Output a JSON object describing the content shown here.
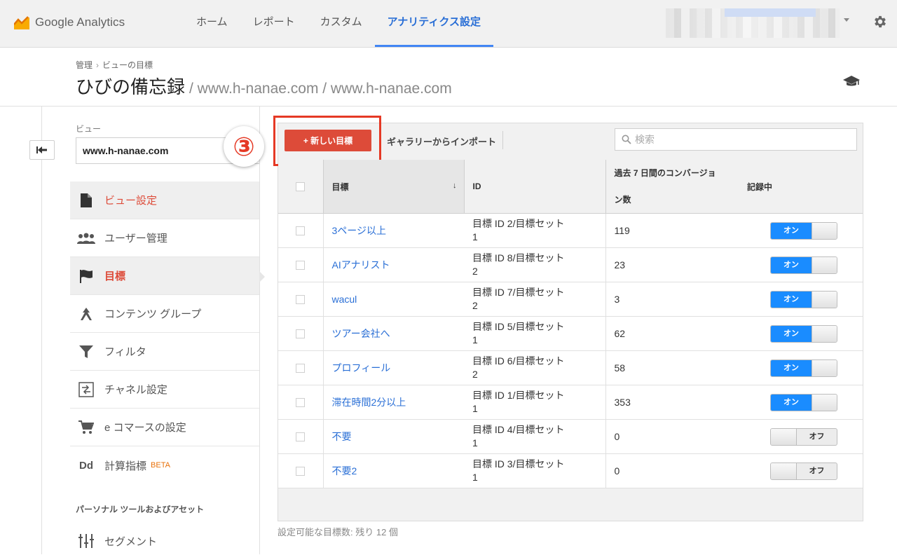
{
  "app": {
    "name": "Google Analytics",
    "brand_color": "#f9ab00",
    "accent_color": "#4285f4"
  },
  "nav": [
    {
      "label": "ホーム",
      "active": false
    },
    {
      "label": "レポート",
      "active": false
    },
    {
      "label": "カスタム",
      "active": false
    },
    {
      "label": "アナリティクス設定",
      "active": true
    }
  ],
  "header": {
    "breadcrumb": [
      "管理",
      "ビューの目標"
    ],
    "title": "ひびの備忘録",
    "subtitle": "/ www.h-nanae.com / www.h-nanae.com"
  },
  "view": {
    "label": "ビュー",
    "selected": "www.h-nanae.com"
  },
  "menu": [
    {
      "label": "ビュー設定",
      "icon": "document-icon"
    },
    {
      "label": "ユーザー管理",
      "icon": "people-icon"
    },
    {
      "label": "目標",
      "icon": "flag-icon"
    },
    {
      "label": "コンテンツ グループ",
      "icon": "content-group-icon"
    },
    {
      "label": "フィルタ",
      "icon": "filter-icon"
    },
    {
      "label": "チャネル設定",
      "icon": "channel-icon"
    },
    {
      "label": "e コマースの設定",
      "icon": "cart-icon"
    },
    {
      "label": "計算指標",
      "icon": "dd-icon",
      "badge": "BETA"
    }
  ],
  "menu_section": "パーソナル ツールおよびアセット",
  "menu_segment": {
    "label": "セグメント",
    "icon": "segment-icon"
  },
  "toolbar": {
    "new_goal": "+ 新しい目標",
    "import": "ギャラリーからインポート",
    "search_placeholder": "検索"
  },
  "annotation": {
    "step": "③",
    "color": "#e53925"
  },
  "table": {
    "headers": {
      "goal": "目標",
      "id": "ID",
      "conv_line1": "過去 7 日間のコンバージョ",
      "conv_line2": "ン数",
      "recording": "記録中"
    },
    "rows": [
      {
        "name": "3ページ以上",
        "id_line1": "目標 ID 2/目標セット",
        "id_line2": "1",
        "conversions": "119",
        "recording": "オン"
      },
      {
        "name": "AIアナリスト",
        "id_line1": "目標 ID 8/目標セット",
        "id_line2": "2",
        "conversions": "23",
        "recording": "オン"
      },
      {
        "name": "wacul",
        "id_line1": "目標 ID 7/目標セット",
        "id_line2": "2",
        "conversions": "3",
        "recording": "オン"
      },
      {
        "name": "ツアー会社へ",
        "id_line1": "目標 ID 5/目標セット",
        "id_line2": "1",
        "conversions": "62",
        "recording": "オン"
      },
      {
        "name": "プロフィール",
        "id_line1": "目標 ID 6/目標セット",
        "id_line2": "2",
        "conversions": "58",
        "recording": "オン"
      },
      {
        "name": "滞在時間2分以上",
        "id_line1": "目標 ID 1/目標セット",
        "id_line2": "1",
        "conversions": "353",
        "recording": "オン"
      },
      {
        "name": "不要",
        "id_line1": "目標 ID 4/目標セット",
        "id_line2": "1",
        "conversions": "0",
        "recording": "オフ"
      },
      {
        "name": "不要2",
        "id_line1": "目標 ID 3/目標セット",
        "id_line2": "1",
        "conversions": "0",
        "recording": "オフ"
      }
    ]
  },
  "footer": {
    "remaining": "設定可能な目標数: 残り 12 個"
  }
}
